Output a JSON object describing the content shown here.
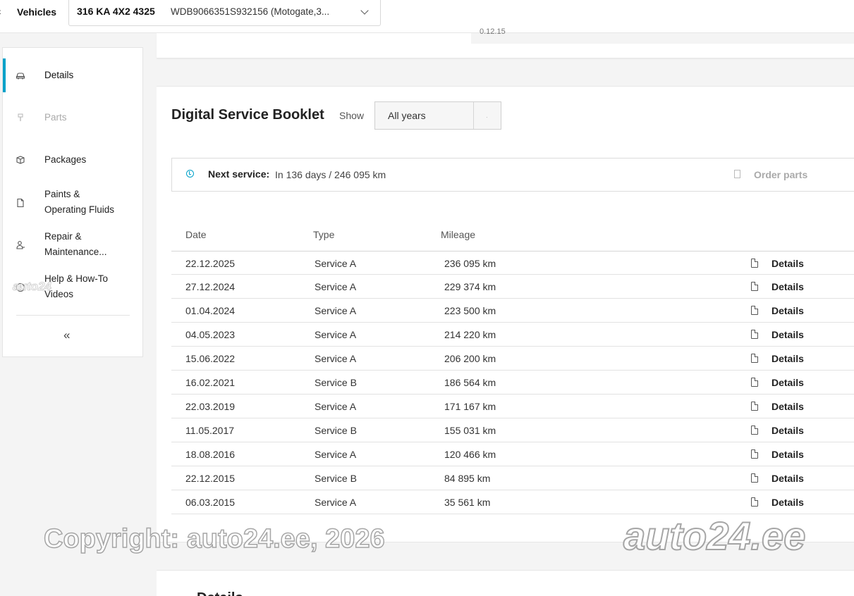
{
  "topbar": {
    "back_glyph": "‹",
    "vehicles_label": "Vehicles",
    "vehicle_name": "316 KA 4X2 4325",
    "vehicle_vin": "WDB9066351S932156 (Motogate,3...",
    "top_card_text": "0.12.15"
  },
  "sidebar": {
    "items": [
      {
        "label": "Details",
        "icon": "car-icon",
        "state": "active"
      },
      {
        "label": "Parts",
        "icon": "wrench-icon",
        "state": "disabled"
      },
      {
        "label": "Packages",
        "icon": "box-icon",
        "state": "normal"
      },
      {
        "label_line1": "Paints &",
        "label_line2": "Operating Fluids",
        "icon": "document-icon",
        "state": "normal"
      },
      {
        "label_line1": "Repair &",
        "label_line2": "Maintenance...",
        "icon": "mechanic-icon",
        "state": "normal"
      },
      {
        "label_line1": "Help & How-To",
        "label_line2": "Videos",
        "icon": "help-icon",
        "state": "normal"
      }
    ],
    "collapse_glyph": "«"
  },
  "booklet": {
    "title": "Digital Service Booklet",
    "show_label": "Show",
    "year_filter": "All years",
    "next_service_label": "Next service:",
    "next_service_value": "In 136 days / 246 095 km",
    "order_parts_label": "Order parts",
    "columns": {
      "date": "Date",
      "type": "Type",
      "mileage": "Mileage"
    },
    "rows": [
      {
        "date": "22.12.2025",
        "type": "Service A",
        "mileage": "236 095 km",
        "action": "Details"
      },
      {
        "date": "27.12.2024",
        "type": "Service A",
        "mileage": "229 374 km",
        "action": "Details"
      },
      {
        "date": "01.04.2024",
        "type": "Service A",
        "mileage": "223 500 km",
        "action": "Details"
      },
      {
        "date": "04.05.2023",
        "type": "Service A",
        "mileage": "214 220 km",
        "action": "Details"
      },
      {
        "date": "15.06.2022",
        "type": "Service A",
        "mileage": "206 200 km",
        "action": "Details"
      },
      {
        "date": "16.02.2021",
        "type": "Service B",
        "mileage": "186 564 km",
        "action": "Details"
      },
      {
        "date": "22.03.2019",
        "type": "Service A",
        "mileage": "171 167 km",
        "action": "Details"
      },
      {
        "date": "11.05.2017",
        "type": "Service B",
        "mileage": "155 031 km",
        "action": "Details"
      },
      {
        "date": "18.08.2016",
        "type": "Service A",
        "mileage": "120 466 km",
        "action": "Details"
      },
      {
        "date": "22.12.2015",
        "type": "Service B",
        "mileage": "84 895 km",
        "action": "Details"
      },
      {
        "date": "06.03.2015",
        "type": "Service A",
        "mileage": "35 561 km",
        "action": "Details"
      }
    ]
  },
  "bottom_card": {
    "title": "Details"
  },
  "watermarks": {
    "copyright": "Copyright: auto24.ee, 2026",
    "brand": "auto24.ee",
    "small": "auto24"
  },
  "colors": {
    "accent": "#00a1c9"
  }
}
